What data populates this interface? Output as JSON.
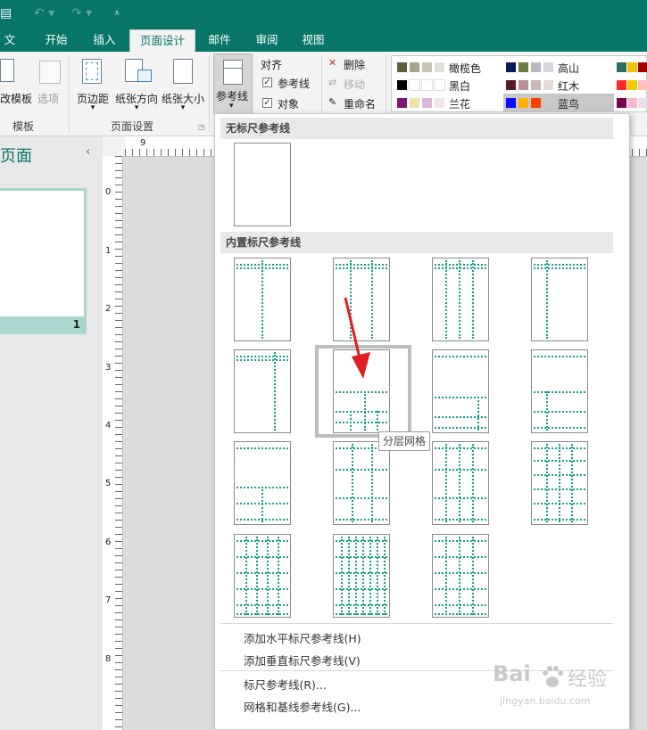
{
  "titlebar": {
    "save_icon": "save-icon",
    "undo_icon": "undo-icon",
    "redo_icon": "redo-icon",
    "customize_icon": "customize-qat-icon"
  },
  "tabs": [
    {
      "label": "文件",
      "active": false
    },
    {
      "label": "开始",
      "active": false
    },
    {
      "label": "插入",
      "active": false
    },
    {
      "label": "页面设计",
      "active": true
    },
    {
      "label": "邮件",
      "active": false
    },
    {
      "label": "审阅",
      "active": false
    },
    {
      "label": "视图",
      "active": false
    }
  ],
  "ribbon": {
    "template_group": {
      "change_template": "改模板",
      "options": "选项",
      "label": "模板"
    },
    "page_setup_group": {
      "margins": "页边距",
      "orientation": "纸张方向",
      "size": "纸张大小",
      "label": "页面设置"
    },
    "guides": "参考线",
    "align": {
      "title": "对齐",
      "guides_check": "参考线",
      "objects_check": "对象"
    },
    "pages": {
      "delete": "删除",
      "move": "移动",
      "rename": "重命名"
    },
    "color_schemes": [
      {
        "name": "橄榄色",
        "colors": [
          "#5f5e3a",
          "#a7a48a",
          "#c6c4b4",
          "#e2e0d6"
        ]
      },
      {
        "name": "高山",
        "colors": [
          "#061d5b",
          "#6e7c44",
          "#b8b9c0",
          "#d7d7dd"
        ]
      },
      {
        "name": "黑白",
        "colors": [
          "#000000",
          "#ffffff",
          "#ffffff",
          "#ffffff"
        ]
      },
      {
        "name": "红木",
        "colors": [
          "#5c1a28",
          "#b89497",
          "#c9b8b5",
          "#e4dad7"
        ]
      },
      {
        "name": "兰花",
        "colors": [
          "#80166e",
          "#efe4a8",
          "#dcb6d6",
          "#f0e3ee"
        ]
      },
      {
        "name": "蓝鸟",
        "colors": [
          "#0b0bff",
          "#ffb000",
          "#ff4000",
          "#c8c8c8"
        ]
      }
    ],
    "extra_scheme_colors": [
      [
        "#2d6d68",
        "#f2c200",
        "#a40000"
      ],
      [
        "#ff2b2b",
        "#f0c900",
        "#ffc0c0"
      ],
      [
        "#780050",
        "#f4b8d0",
        "#e8e0e8"
      ]
    ]
  },
  "left_pane": {
    "title": "页面",
    "collapse_icon": "chevron-left-icon",
    "page_number": "1"
  },
  "rulers": {
    "h_label": "9",
    "v_labels": [
      "0",
      "1",
      "2",
      "3",
      "4",
      "5",
      "6",
      "7",
      "8"
    ]
  },
  "dropdown": {
    "no_ruler_header": "无标尺参考线",
    "builtin_header": "内置标尺参考线",
    "tooltip": "分层网格",
    "menu": [
      "添加水平标尺参考线(H)",
      "添加垂直标尺参考线(V)",
      "标尺参考线(R)...",
      "网格和基线参考线(G)..."
    ]
  },
  "watermark": {
    "brand": "Bai",
    "brand_cn": "经验",
    "url": "jingyan.baidu.com"
  }
}
